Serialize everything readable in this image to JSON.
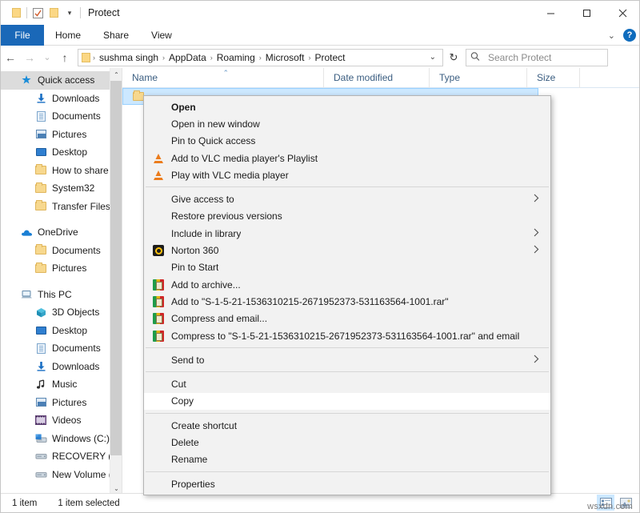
{
  "window": {
    "title": "Protect",
    "quick_access_toolbar": [
      {
        "name": "properties-folder-icon",
        "label": ""
      },
      {
        "name": "properties-checkbox-icon",
        "label": ""
      },
      {
        "name": "new-folder-icon",
        "label": ""
      },
      {
        "name": "customize-dropdown-icon",
        "label": "▾"
      }
    ],
    "controls": {
      "minimize": "—",
      "maximize": "▢",
      "close": "✕"
    }
  },
  "ribbon": {
    "tabs": [
      {
        "label": "File",
        "active": true
      },
      {
        "label": "Home",
        "active": false
      },
      {
        "label": "Share",
        "active": false
      },
      {
        "label": "View",
        "active": false
      }
    ],
    "collapse_icon": "⌄",
    "help_label": "?"
  },
  "address_bar": {
    "back_icon": "←",
    "forward_icon": "→",
    "recent_icon": "⌄",
    "up_icon": "↑",
    "breadcrumbs": [
      "sushma singh",
      "AppData",
      "Roaming",
      "Microsoft",
      "Protect"
    ],
    "separator": "›",
    "dropdown_icon": "⌄",
    "refresh_icon": "↻",
    "search_placeholder": "Search Protect",
    "search_value": ""
  },
  "sidebar": {
    "items": [
      {
        "label": "Quick access",
        "icon": "star-pin-icon",
        "level": 0,
        "selected": true,
        "pinned": false
      },
      {
        "label": "Downloads",
        "icon": "downloads-icon",
        "level": 1,
        "selected": false,
        "pinned": true
      },
      {
        "label": "Documents",
        "icon": "documents-icon",
        "level": 1,
        "selected": false,
        "pinned": true
      },
      {
        "label": "Pictures",
        "icon": "pictures-icon",
        "level": 1,
        "selected": false,
        "pinned": true
      },
      {
        "label": "Desktop",
        "icon": "desktop-icon",
        "level": 1,
        "selected": false,
        "pinned": false
      },
      {
        "label": "How to share yo",
        "icon": "folder-icon",
        "level": 1,
        "selected": false,
        "pinned": false
      },
      {
        "label": "System32",
        "icon": "folder-icon",
        "level": 1,
        "selected": false,
        "pinned": false
      },
      {
        "label": "Transfer Files fro",
        "icon": "folder-icon",
        "level": 1,
        "selected": false,
        "pinned": false
      },
      {
        "label": "__GAP__",
        "icon": "",
        "level": 0,
        "selected": false,
        "pinned": false
      },
      {
        "label": "OneDrive",
        "icon": "cloud-icon",
        "level": 0,
        "selected": false,
        "pinned": false
      },
      {
        "label": "Documents",
        "icon": "folder-icon",
        "level": 1,
        "selected": false,
        "pinned": false
      },
      {
        "label": "Pictures",
        "icon": "folder-icon",
        "level": 1,
        "selected": false,
        "pinned": false
      },
      {
        "label": "__GAP__",
        "icon": "",
        "level": 0,
        "selected": false,
        "pinned": false
      },
      {
        "label": "This PC",
        "icon": "this-pc-icon",
        "level": 0,
        "selected": false,
        "pinned": false
      },
      {
        "label": "3D Objects",
        "icon": "3d-objects-icon",
        "level": 1,
        "selected": false,
        "pinned": false
      },
      {
        "label": "Desktop",
        "icon": "desktop-icon",
        "level": 1,
        "selected": false,
        "pinned": false
      },
      {
        "label": "Documents",
        "icon": "documents-icon",
        "level": 1,
        "selected": false,
        "pinned": false
      },
      {
        "label": "Downloads",
        "icon": "downloads-icon",
        "level": 1,
        "selected": false,
        "pinned": false
      },
      {
        "label": "Music",
        "icon": "music-icon",
        "level": 1,
        "selected": false,
        "pinned": false
      },
      {
        "label": "Pictures",
        "icon": "pictures-icon",
        "level": 1,
        "selected": false,
        "pinned": false
      },
      {
        "label": "Videos",
        "icon": "videos-icon",
        "level": 1,
        "selected": false,
        "pinned": false
      },
      {
        "label": "Windows (C:)",
        "icon": "windows-drive-icon",
        "level": 1,
        "selected": false,
        "pinned": false
      },
      {
        "label": "RECOVERY (D:)",
        "icon": "drive-icon",
        "level": 1,
        "selected": false,
        "pinned": false
      },
      {
        "label": "New Volume (E:)",
        "icon": "drive-icon",
        "level": 1,
        "selected": false,
        "pinned": false
      }
    ],
    "scroll_up_icon": "⌃",
    "scroll_down_icon": "⌄"
  },
  "file_list": {
    "columns": [
      {
        "label": "Name",
        "sorted": true,
        "sort_icon": "⌃"
      },
      {
        "label": "Date modified",
        "sorted": false,
        "sort_icon": ""
      },
      {
        "label": "Type",
        "sorted": false,
        "sort_icon": ""
      },
      {
        "label": "Size",
        "sorted": false,
        "sort_icon": ""
      }
    ],
    "rows": [
      {
        "name": "",
        "icon": "folder-icon",
        "date_modified": "",
        "type": "",
        "size": "",
        "selected": true
      }
    ]
  },
  "context_menu": {
    "items": [
      {
        "label": "Open",
        "icon": "",
        "bold": true,
        "submenu": false,
        "separator_after": false,
        "highlighted": false
      },
      {
        "label": "Open in new window",
        "icon": "",
        "bold": false,
        "submenu": false,
        "separator_after": false,
        "highlighted": false
      },
      {
        "label": "Pin to Quick access",
        "icon": "",
        "bold": false,
        "submenu": false,
        "separator_after": false,
        "highlighted": false
      },
      {
        "label": "Add to VLC media player's Playlist",
        "icon": "vlc-icon",
        "bold": false,
        "submenu": false,
        "separator_after": false,
        "highlighted": false
      },
      {
        "label": "Play with VLC media player",
        "icon": "vlc-icon",
        "bold": false,
        "submenu": false,
        "separator_after": true,
        "highlighted": false
      },
      {
        "label": "Give access to",
        "icon": "",
        "bold": false,
        "submenu": true,
        "separator_after": false,
        "highlighted": false
      },
      {
        "label": "Restore previous versions",
        "icon": "",
        "bold": false,
        "submenu": false,
        "separator_after": false,
        "highlighted": false
      },
      {
        "label": "Include in library",
        "icon": "",
        "bold": false,
        "submenu": true,
        "separator_after": false,
        "highlighted": false
      },
      {
        "label": "Norton 360",
        "icon": "norton-icon",
        "bold": false,
        "submenu": true,
        "separator_after": false,
        "highlighted": false
      },
      {
        "label": "Pin to Start",
        "icon": "",
        "bold": false,
        "submenu": false,
        "separator_after": false,
        "highlighted": false
      },
      {
        "label": "Add to archive...",
        "icon": "winrar-icon",
        "bold": false,
        "submenu": false,
        "separator_after": false,
        "highlighted": false
      },
      {
        "label": "Add to \"S-1-5-21-1536310215-2671952373-531163564-1001.rar\"",
        "icon": "winrar-icon",
        "bold": false,
        "submenu": false,
        "separator_after": false,
        "highlighted": false
      },
      {
        "label": "Compress and email...",
        "icon": "winrar-icon",
        "bold": false,
        "submenu": false,
        "separator_after": false,
        "highlighted": false
      },
      {
        "label": "Compress to \"S-1-5-21-1536310215-2671952373-531163564-1001.rar\" and email",
        "icon": "winrar-icon",
        "bold": false,
        "submenu": false,
        "separator_after": true,
        "highlighted": false
      },
      {
        "label": "Send to",
        "icon": "",
        "bold": false,
        "submenu": true,
        "separator_after": true,
        "highlighted": false
      },
      {
        "label": "Cut",
        "icon": "",
        "bold": false,
        "submenu": false,
        "separator_after": false,
        "highlighted": false
      },
      {
        "label": "Copy",
        "icon": "",
        "bold": false,
        "submenu": false,
        "separator_after": true,
        "highlighted": true
      },
      {
        "label": "Create shortcut",
        "icon": "",
        "bold": false,
        "submenu": false,
        "separator_after": false,
        "highlighted": false
      },
      {
        "label": "Delete",
        "icon": "",
        "bold": false,
        "submenu": false,
        "separator_after": false,
        "highlighted": false
      },
      {
        "label": "Rename",
        "icon": "",
        "bold": false,
        "submenu": false,
        "separator_after": true,
        "highlighted": false
      },
      {
        "label": "Properties",
        "icon": "",
        "bold": false,
        "submenu": false,
        "separator_after": false,
        "highlighted": false
      }
    ],
    "submenu_arrow": "›"
  },
  "status_bar": {
    "item_count": "1 item",
    "selection": "1 item selected",
    "view_buttons": [
      {
        "name": "details-view-icon",
        "active": true
      },
      {
        "name": "large-icons-view-icon",
        "active": false
      }
    ]
  },
  "watermark": "wsxdn.com",
  "colors": {
    "accent": "#1a68b8",
    "selection": "#cce8ff",
    "menu_bg": "#f2f2f2",
    "breadcrumb_text": "#1b1b1b"
  }
}
